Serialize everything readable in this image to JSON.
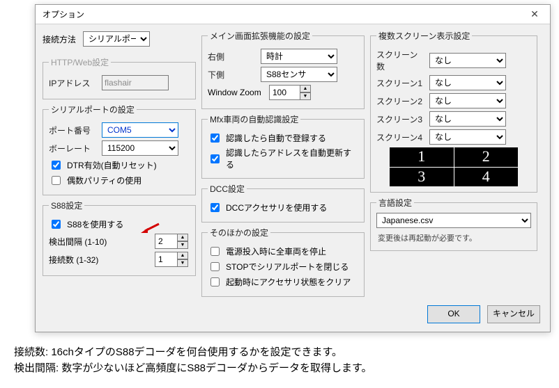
{
  "window": {
    "title": "オプション"
  },
  "connection": {
    "label": "接続方法",
    "value": "シリアルポート"
  },
  "http": {
    "legend": "HTTP/Web設定",
    "ip_label": "IPアドレス",
    "ip_value": "flashair"
  },
  "serial": {
    "legend": "シリアルポートの設定",
    "port_label": "ポート番号",
    "port_value": "COM5",
    "baud_label": "ボーレート",
    "baud_value": "115200",
    "dtr_label": "DTR有効(自動リセット)",
    "parity_label": "偶数パリティの使用"
  },
  "s88": {
    "legend": "S88設定",
    "use_label": "S88を使用する",
    "interval_label": "検出間隔 (1-10)",
    "interval_value": "2",
    "count_label": "接続数 (1-32)",
    "count_value": "1"
  },
  "mainext": {
    "legend": "メイン画面拡張機能の設定",
    "right_label": "右側",
    "right_value": "時計",
    "bottom_label": "下側",
    "bottom_value": "S88センサ",
    "zoom_label": "Window Zoom",
    "zoom_value": "100"
  },
  "mfx": {
    "legend": "Mfx車両の自動認識設定",
    "auto_register": "認識したら自動で登録する",
    "auto_update_addr": "認識したらアドレスを自動更新する"
  },
  "dcc": {
    "legend": "DCC設定",
    "use_accessory": "DCCアクセサリを使用する"
  },
  "other": {
    "legend": "そのほかの設定",
    "stop_all_on_power": "電源投入時に全車両を停止",
    "close_port_on_stop": "STOPでシリアルポートを閉じる",
    "clear_accessory_on_start": "起動時にアクセサリ状態をクリア"
  },
  "screens": {
    "legend": "複数スクリーン表示設定",
    "count_label": "スクリーン数",
    "count_value": "なし",
    "s1_label": "スクリーン1",
    "s1_value": "なし",
    "s2_label": "スクリーン2",
    "s2_value": "なし",
    "s3_label": "スクリーン3",
    "s3_value": "なし",
    "s4_label": "スクリーン4",
    "s4_value": "なし",
    "tiles": [
      "1",
      "2",
      "3",
      "4"
    ]
  },
  "lang": {
    "legend": "言語設定",
    "value": "Japanese.csv",
    "note": "変更後は再起動が必要です。"
  },
  "buttons": {
    "ok": "OK",
    "cancel": "キャンセル"
  },
  "caption": {
    "line1": "接続数: 16chタイプのS88デコーダを何台使用するかを設定できます。",
    "line2": "検出間隔: 数字が少ないほど高頻度にS88デコーダからデータを取得します。"
  }
}
